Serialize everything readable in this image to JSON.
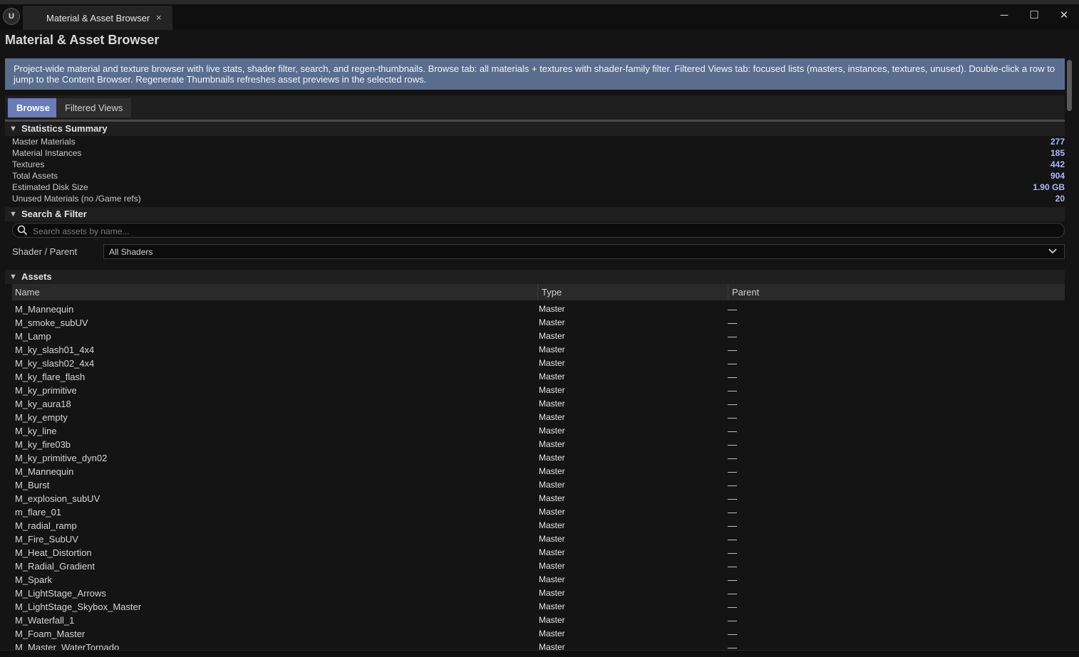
{
  "window": {
    "tab_title": "Material & Asset Browser",
    "tab_close": "×",
    "logo": "U",
    "minimize": "─",
    "maximize": "☐",
    "close": "✕"
  },
  "page_title": "Material & Asset Browser",
  "info_text": "Project-wide material and texture browser with live stats, shader filter, search, and regen-thumbnails. Browse tab: all materials + textures with shader-family filter. Filtered Views tab: focused lists (masters, instances, textures, unused). Double-click a row to jump to the Content Browser. Regenerate Thumbnails refreshes asset previews in the selected rows.",
  "tabs": [
    {
      "label": "Browse",
      "active": true
    },
    {
      "label": "Filtered Views",
      "active": false
    }
  ],
  "statistics": {
    "title": "Statistics Summary",
    "rows": [
      {
        "label": "Master Materials",
        "value": "277"
      },
      {
        "label": "Material Instances",
        "value": "185"
      },
      {
        "label": "Textures",
        "value": "442"
      },
      {
        "label": "Total Assets",
        "value": "904"
      },
      {
        "label": "Estimated Disk Size",
        "value": "1.90 GB"
      },
      {
        "label": "Unused Materials (no /Game refs)",
        "value": "20"
      }
    ]
  },
  "search_filter": {
    "title": "Search & Filter",
    "search_placeholder": "Search assets by name...",
    "shader_label": "Shader / Parent",
    "shader_value": "All Shaders"
  },
  "assets": {
    "title": "Assets",
    "columns": [
      "Name",
      "Type",
      "Parent"
    ],
    "rows": [
      {
        "name": "M_Mannequin",
        "type": "Master",
        "parent": "—"
      },
      {
        "name": "M_smoke_subUV",
        "type": "Master",
        "parent": "—"
      },
      {
        "name": "M_Lamp",
        "type": "Master",
        "parent": "—"
      },
      {
        "name": "M_ky_slash01_4x4",
        "type": "Master",
        "parent": "—"
      },
      {
        "name": "M_ky_slash02_4x4",
        "type": "Master",
        "parent": "—"
      },
      {
        "name": "M_ky_flare_flash",
        "type": "Master",
        "parent": "—"
      },
      {
        "name": "M_ky_primitive",
        "type": "Master",
        "parent": "—"
      },
      {
        "name": "M_ky_aura18",
        "type": "Master",
        "parent": "—"
      },
      {
        "name": "M_ky_empty",
        "type": "Master",
        "parent": "—"
      },
      {
        "name": "M_ky_line",
        "type": "Master",
        "parent": "—"
      },
      {
        "name": "M_ky_fire03b",
        "type": "Master",
        "parent": "—"
      },
      {
        "name": "M_ky_primitive_dyn02",
        "type": "Master",
        "parent": "—"
      },
      {
        "name": "M_Mannequin",
        "type": "Master",
        "parent": "—"
      },
      {
        "name": "M_Burst",
        "type": "Master",
        "parent": "—"
      },
      {
        "name": "M_explosion_subUV",
        "type": "Master",
        "parent": "—"
      },
      {
        "name": "m_flare_01",
        "type": "Master",
        "parent": "—"
      },
      {
        "name": "M_radial_ramp",
        "type": "Master",
        "parent": "—"
      },
      {
        "name": "M_Fire_SubUV",
        "type": "Master",
        "parent": "—"
      },
      {
        "name": "M_Heat_Distortion",
        "type": "Master",
        "parent": "—"
      },
      {
        "name": "M_Radial_Gradient",
        "type": "Master",
        "parent": "—"
      },
      {
        "name": "M_Spark",
        "type": "Master",
        "parent": "—"
      },
      {
        "name": "M_LightStage_Arrows",
        "type": "Master",
        "parent": "—"
      },
      {
        "name": "M_LightStage_Skybox_Master",
        "type": "Master",
        "parent": "—"
      },
      {
        "name": "M_Waterfall_1",
        "type": "Master",
        "parent": "—"
      },
      {
        "name": "M_Foam_Master",
        "type": "Master",
        "parent": "—"
      },
      {
        "name": "M_Master_WaterTornado",
        "type": "Master",
        "parent": "—"
      }
    ]
  },
  "icons": {
    "section_expanded": "triangle-down-icon",
    "search": "search-icon",
    "dropdown": "chevron-down-icon"
  },
  "colors": {
    "info_banner": "#5a6d8f",
    "active_tab": "#6b7ab8",
    "stat_value": "#a9b8ff"
  }
}
